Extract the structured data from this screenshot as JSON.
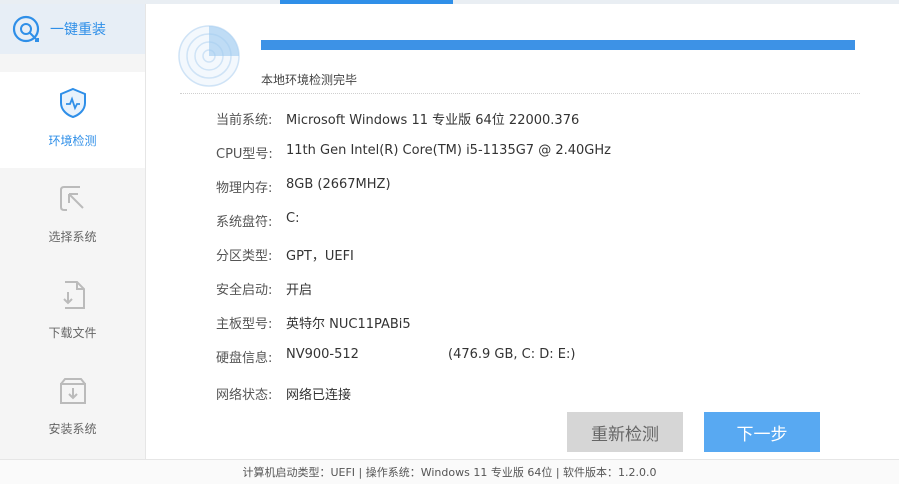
{
  "app": {
    "title": "一键重装"
  },
  "sidebar": {
    "items": [
      {
        "label": "环境检测",
        "icon": "shield-pulse-icon",
        "active": true
      },
      {
        "label": "选择系统",
        "icon": "cursor-select-icon",
        "active": false
      },
      {
        "label": "下载文件",
        "icon": "file-download-icon",
        "active": false
      },
      {
        "label": "安装系统",
        "icon": "box-install-icon",
        "active": false
      }
    ]
  },
  "scan": {
    "progress_percent": 100,
    "status": "本地环境检测完毕"
  },
  "info": [
    {
      "key": "当前系统:",
      "value": "Microsoft Windows 11 专业版 64位 22000.376"
    },
    {
      "key": "CPU型号:",
      "value": "11th Gen Intel(R) Core(TM) i5-1135G7 @ 2.40GHz"
    },
    {
      "key": "物理内存:",
      "value": "8GB (2667MHZ)"
    },
    {
      "key": "系统盘符:",
      "value": "C:"
    },
    {
      "key": "分区类型:",
      "value": "GPT，UEFI"
    },
    {
      "key": "安全启动:",
      "value": "开启"
    },
    {
      "key": "主板型号:",
      "value": "英特尔 NUC11PABi5"
    },
    {
      "key": "硬盘信息:",
      "value": "NV900-512",
      "extra": "(476.9 GB, C: D: E:)"
    },
    {
      "key": "网络状态:",
      "value": "网络已连接"
    }
  ],
  "buttons": {
    "rescan": "重新检测",
    "next": "下一步"
  },
  "footer": {
    "text": "计算机启动类型：UEFI | 操作系统：Windows 11 专业版 64位 | 软件版本：1.2.0.0"
  },
  "colors": {
    "accent": "#2f8fe8",
    "progress": "#3d92e6",
    "next_button": "#58a9f2",
    "rescan_button": "#d6d6d6"
  }
}
